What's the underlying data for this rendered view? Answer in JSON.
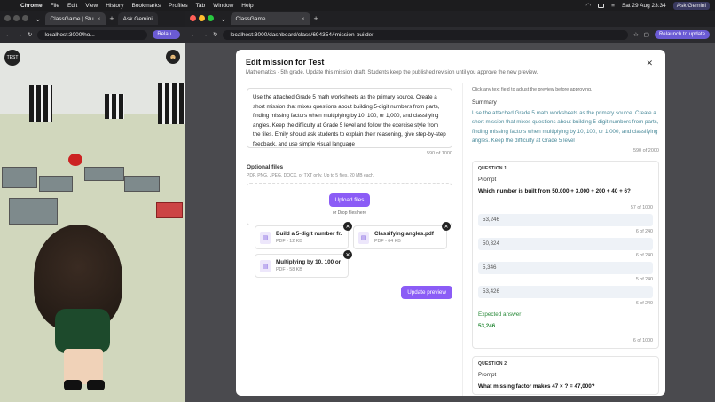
{
  "menubar": {
    "app": "Chrome",
    "items": [
      "File",
      "Edit",
      "View",
      "History",
      "Bookmarks",
      "Profiles",
      "Tab",
      "Window",
      "Help"
    ],
    "datetime": "Sat 29 Aug  23:34",
    "gemini": "Ask Gemini"
  },
  "left_window": {
    "tab_title": "ClassGame | Stu",
    "gemini_tab": "Ask Gemini",
    "url": "localhost:3000/ho...",
    "relaunch": "Relau...",
    "test_badge": "TEST"
  },
  "right_window": {
    "tab_title": "ClassGame",
    "url": "localhost:3000/dashboard/class/694354#mission-builder",
    "relaunch": "Relaunch to update"
  },
  "modal": {
    "title": "Edit mission for Test",
    "subtitle": "Mathematics · 5th grade. Update this mission draft. Students keep the published revision until you approve the new preview.",
    "prompt_text": "Use the attached Grade 5 math worksheets as the primary source. Create a short mission that mixes questions about building 5-digit numbers from parts, finding missing factors when multiplying by 10, 100, or 1,000, and classifying angles. Keep the difficulty at Grade 5 level and follow the exercise style from the files. Emily should ask students to explain their reasoning, give step-by-step feedback, and use simple visual language",
    "prompt_counter": "590 of 1000",
    "optional_files_label": "Optional files",
    "optional_files_hint": "PDF, PNG, JPEG, DOCX, or TXT only. Up to 5 files, 20 MB each.",
    "upload_button": "Upload files",
    "drop_hint": "or Drop files here",
    "files": [
      {
        "name": "Build a 5-digit number fr...",
        "meta": "PDF - 12 KB"
      },
      {
        "name": "Classifying angles.pdf",
        "meta": "PDF - 64 KB"
      },
      {
        "name": "Multiplying by 10, 100 or ...",
        "meta": "PDF - 58 KB"
      }
    ],
    "update_button": "Update preview",
    "right_hint": "Click any text field to adjust the preview before approving.",
    "summary_label": "Summary",
    "summary_text": "Use the attached Grade 5 math worksheets as the primary source. Create a short mission that mixes questions about building 5-digit numbers from parts, finding missing factors when multiplying by 10, 100, or 1,000, and classifying angles. Keep the difficulty at Grade 5 level",
    "summary_counter": "590 of 2000",
    "questions": [
      {
        "label": "QUESTION 1",
        "prompt_label": "Prompt",
        "text": "Which number is built from 50,000 + 3,000 + 200 + 40 + 6?",
        "counter": "57 of 1000",
        "options": [
          {
            "value": "53,246",
            "counter": "6 of 240"
          },
          {
            "value": "50,324",
            "counter": "6 of 240"
          },
          {
            "value": "5,346",
            "counter": "5 of 240"
          },
          {
            "value": "53,426",
            "counter": "6 of 240"
          }
        ],
        "expected_label": "Expected answer",
        "expected_value": "53,246",
        "expected_counter": "6 of 1000"
      },
      {
        "label": "QUESTION 2",
        "prompt_label": "Prompt",
        "text": "What missing factor makes 47 × ? = 47,000?"
      }
    ]
  }
}
